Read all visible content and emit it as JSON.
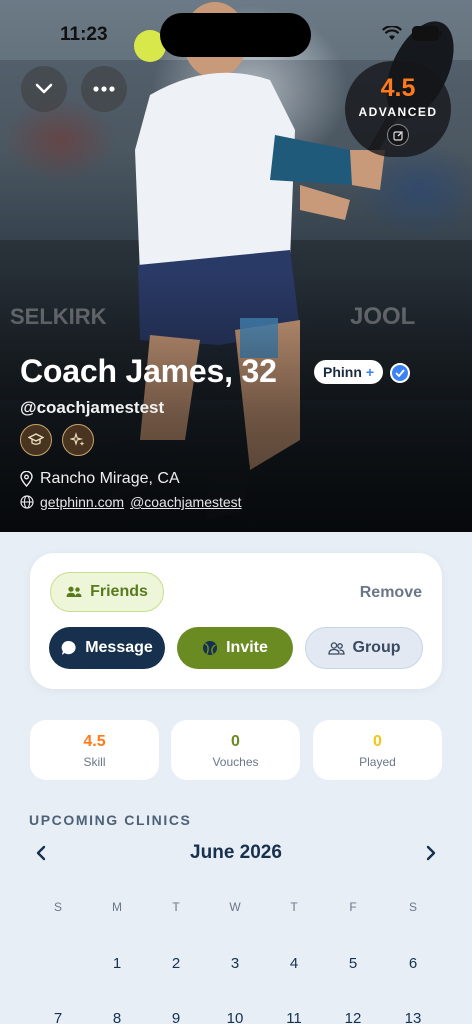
{
  "status_bar": {
    "time": "11:23"
  },
  "hero": {
    "rating": {
      "value": "4.5",
      "level": "ADVANCED"
    },
    "name": "Coach James, 32",
    "membership_badge": "Phinn",
    "membership_plus": "+",
    "handle": "@coachjamestest",
    "location": "Rancho Mirage, CA",
    "website": "getphinn.com",
    "social_handle": "@coachjamestest"
  },
  "actions": {
    "friends_label": "Friends",
    "remove_label": "Remove",
    "message_label": "Message",
    "invite_label": "Invite",
    "group_label": "Group"
  },
  "stats": [
    {
      "value": "4.5",
      "label": "Skill",
      "color": "#ff7a1a"
    },
    {
      "value": "0",
      "label": "Vouches",
      "color": "#6a8a22"
    },
    {
      "value": "0",
      "label": "Played",
      "color": "#f5c518"
    }
  ],
  "clinics": {
    "section_title": "UPCOMING CLINICS",
    "month": "June 2026",
    "weekdays": [
      "S",
      "M",
      "T",
      "W",
      "T",
      "F",
      "S"
    ],
    "week1": [
      "",
      "1",
      "2",
      "3",
      "4",
      "5",
      "6"
    ],
    "week2": [
      "7",
      "8",
      "9",
      "10",
      "11",
      "12",
      "13"
    ]
  },
  "colors": {
    "navy": "#17304d",
    "olive": "#6a8a22",
    "orange": "#ff7a1a",
    "verified_blue": "#3b82f6"
  }
}
